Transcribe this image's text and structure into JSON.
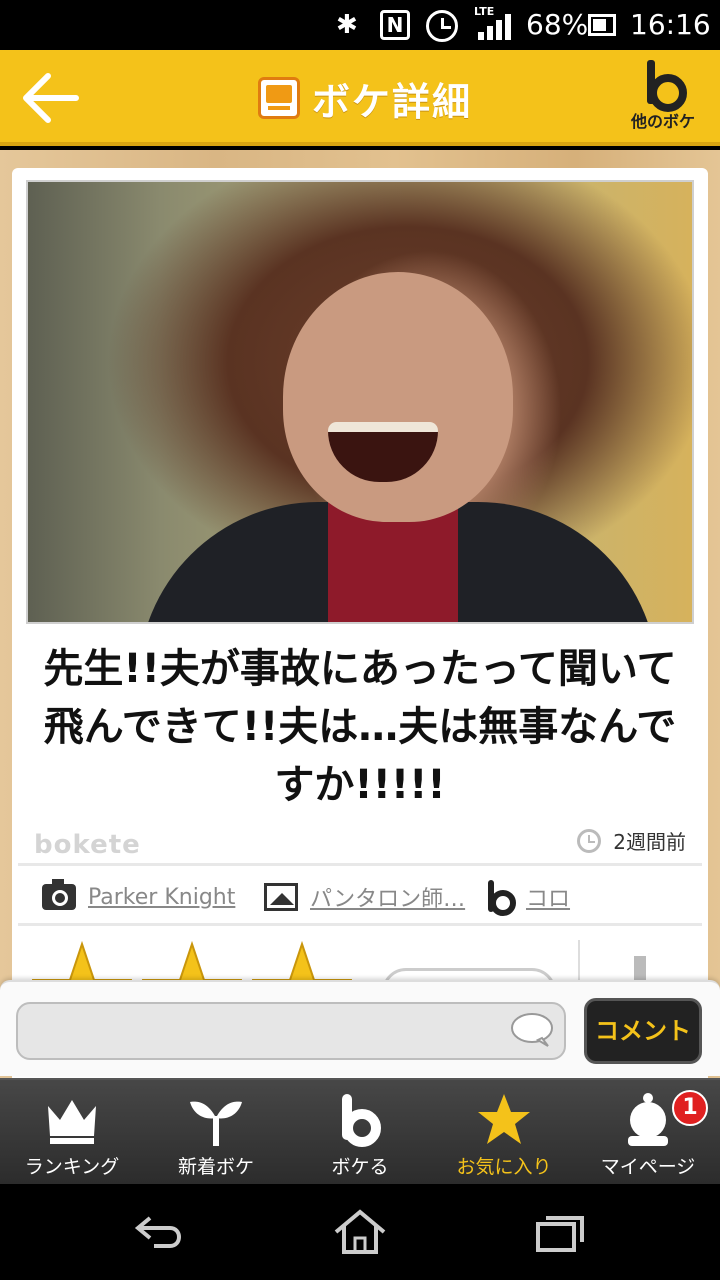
{
  "status_bar": {
    "network": "LTE",
    "battery_percent": "68%",
    "time": "16:16"
  },
  "header": {
    "title": "ボケ詳細",
    "other_label": "他のボケ"
  },
  "post": {
    "caption": "先生!!夫が事故にあったって聞いて飛んできて!!夫は…夫は無事なんですか!!!!!",
    "brand": "bokete",
    "posted": "2週間前",
    "photographer": "Parker Knight",
    "odai_author": "パンタロン師…",
    "boke_author": "コロ",
    "star_color": "#f4c21a"
  },
  "comment": {
    "placeholder": "",
    "button_label": "コメント"
  },
  "tabs": [
    {
      "label": "ランキング",
      "icon": "crown-icon"
    },
    {
      "label": "新着ボケ",
      "icon": "sprout-icon"
    },
    {
      "label": "ボケる",
      "icon": "bokete-b-icon"
    },
    {
      "label": "お気に入り",
      "icon": "star-icon"
    },
    {
      "label": "マイページ",
      "icon": "user-icon",
      "badge": "1"
    }
  ],
  "colors": {
    "accent": "#f4c21a",
    "badge": "#e02020"
  }
}
